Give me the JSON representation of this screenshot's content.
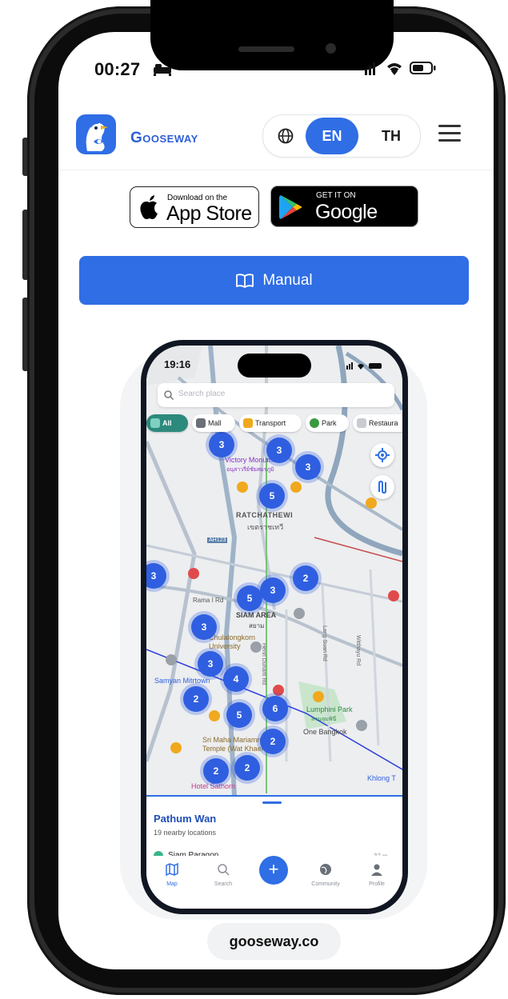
{
  "status": {
    "time": "00:27"
  },
  "header": {
    "brand": "Gooseway",
    "lang_en": "EN",
    "lang_th": "TH"
  },
  "stores": {
    "apple_small": "Download on the",
    "apple_big": "App Store",
    "google_small": "GET IT ON",
    "google_big": "Google Play"
  },
  "manual": {
    "label": "Manual",
    "icon": "book-icon"
  },
  "mockup": {
    "time": "19:16",
    "search_placeholder": "Search place",
    "chips": [
      "All",
      "Mall",
      "Transport",
      "Park",
      "Restaura"
    ],
    "map_labels": {
      "victory": "Victory Monument",
      "victory_th": "อนุสาวรีย์ชัยสมรภูมิ",
      "ratchathewi": "RATCHATHEWI",
      "ratchathewi_th": "เขตราชเทวี",
      "siam": "SIAM AREA",
      "siam_th": "สยาม",
      "chula": "Chulalongkorn University",
      "samyan": "Samyan Mitrtown",
      "lumphini": "Lumphini Park",
      "lumphini_th": "สวนลุมพินี",
      "onebkk": "One Bangkok",
      "mariamman": "Sri Maha Mariamman Temple (Wat Khaek)",
      "hotel": "Hotel Sathorn",
      "khlong": "Khlong T",
      "henri": "Henri Dunant Rd",
      "langsuan": "Lang Suan Rd",
      "witthayu": "Witthayu Rd",
      "rama1": "Rama I Rd",
      "ah123": "AH123"
    },
    "clusters": [
      "3",
      "3",
      "3",
      "5",
      "3",
      "3",
      "2",
      "5",
      "3",
      "4",
      "2",
      "5",
      "6",
      "2",
      "2",
      "2"
    ],
    "sheet": {
      "title": "Pathum Wan",
      "subtitle": "19 nearby locations",
      "first_item": "Siam Paragon",
      "distance": "37 m"
    },
    "tabs": [
      "Map",
      "Search",
      "Community",
      "Profile"
    ],
    "fab": "+"
  },
  "footer": {
    "domain": "gooseway.co"
  },
  "colors": {
    "brand": "#2f6ee5",
    "cluster": "#2f5fe0",
    "frame": "#2b2b2b"
  }
}
